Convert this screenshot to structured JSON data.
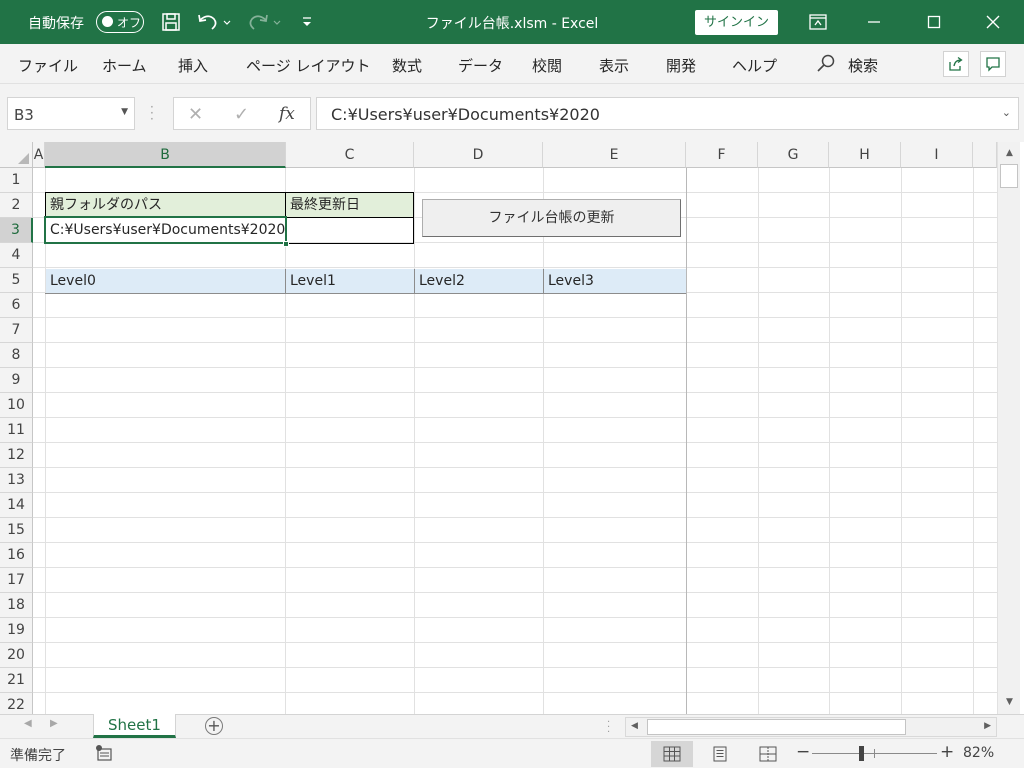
{
  "titlebar": {
    "autosave_label": "自動保存",
    "autosave_state": "オフ",
    "title": "ファイル台帳.xlsm  -  Excel",
    "signin": "サインイン",
    "accent": "#217346"
  },
  "ribbon": {
    "tabs": [
      "ファイル",
      "ホーム",
      "挿入",
      "ページ レイアウト",
      "数式",
      "データ",
      "校閲",
      "表示",
      "開発",
      "ヘルプ"
    ],
    "search_label": "検索"
  },
  "formula_bar": {
    "name_box": "B3",
    "formula": "C:¥Users¥user¥Documents¥2020",
    "cancel_glyph": "✕",
    "enter_glyph": "✓",
    "fx_glyph": "fx"
  },
  "grid": {
    "columns": [
      "A",
      "B",
      "C",
      "D",
      "E",
      "F",
      "G",
      "H",
      "I"
    ],
    "rows": [
      "1",
      "2",
      "3",
      "4",
      "5",
      "6",
      "7",
      "8",
      "9",
      "10",
      "11",
      "12",
      "13",
      "14",
      "15",
      "16",
      "17",
      "18",
      "19",
      "20",
      "21",
      "22"
    ],
    "selected_cell": "B3",
    "cells": {
      "B2": "親フォルダのパス",
      "C2": "最終更新日",
      "B3": "C:¥Users¥user¥Documents¥2020",
      "C3": "",
      "B5": "Level0",
      "C5": "Level1",
      "D5": "Level2",
      "E5": "Level3"
    },
    "button_label": "ファイル台帳の更新",
    "header_green": "#e2efda",
    "header_blue": "#ddebf7"
  },
  "sheet_tabs": {
    "tabs": [
      "Sheet1"
    ],
    "add_glyph": "+"
  },
  "statusbar": {
    "ready": "準備完了",
    "zoom": "82%"
  }
}
